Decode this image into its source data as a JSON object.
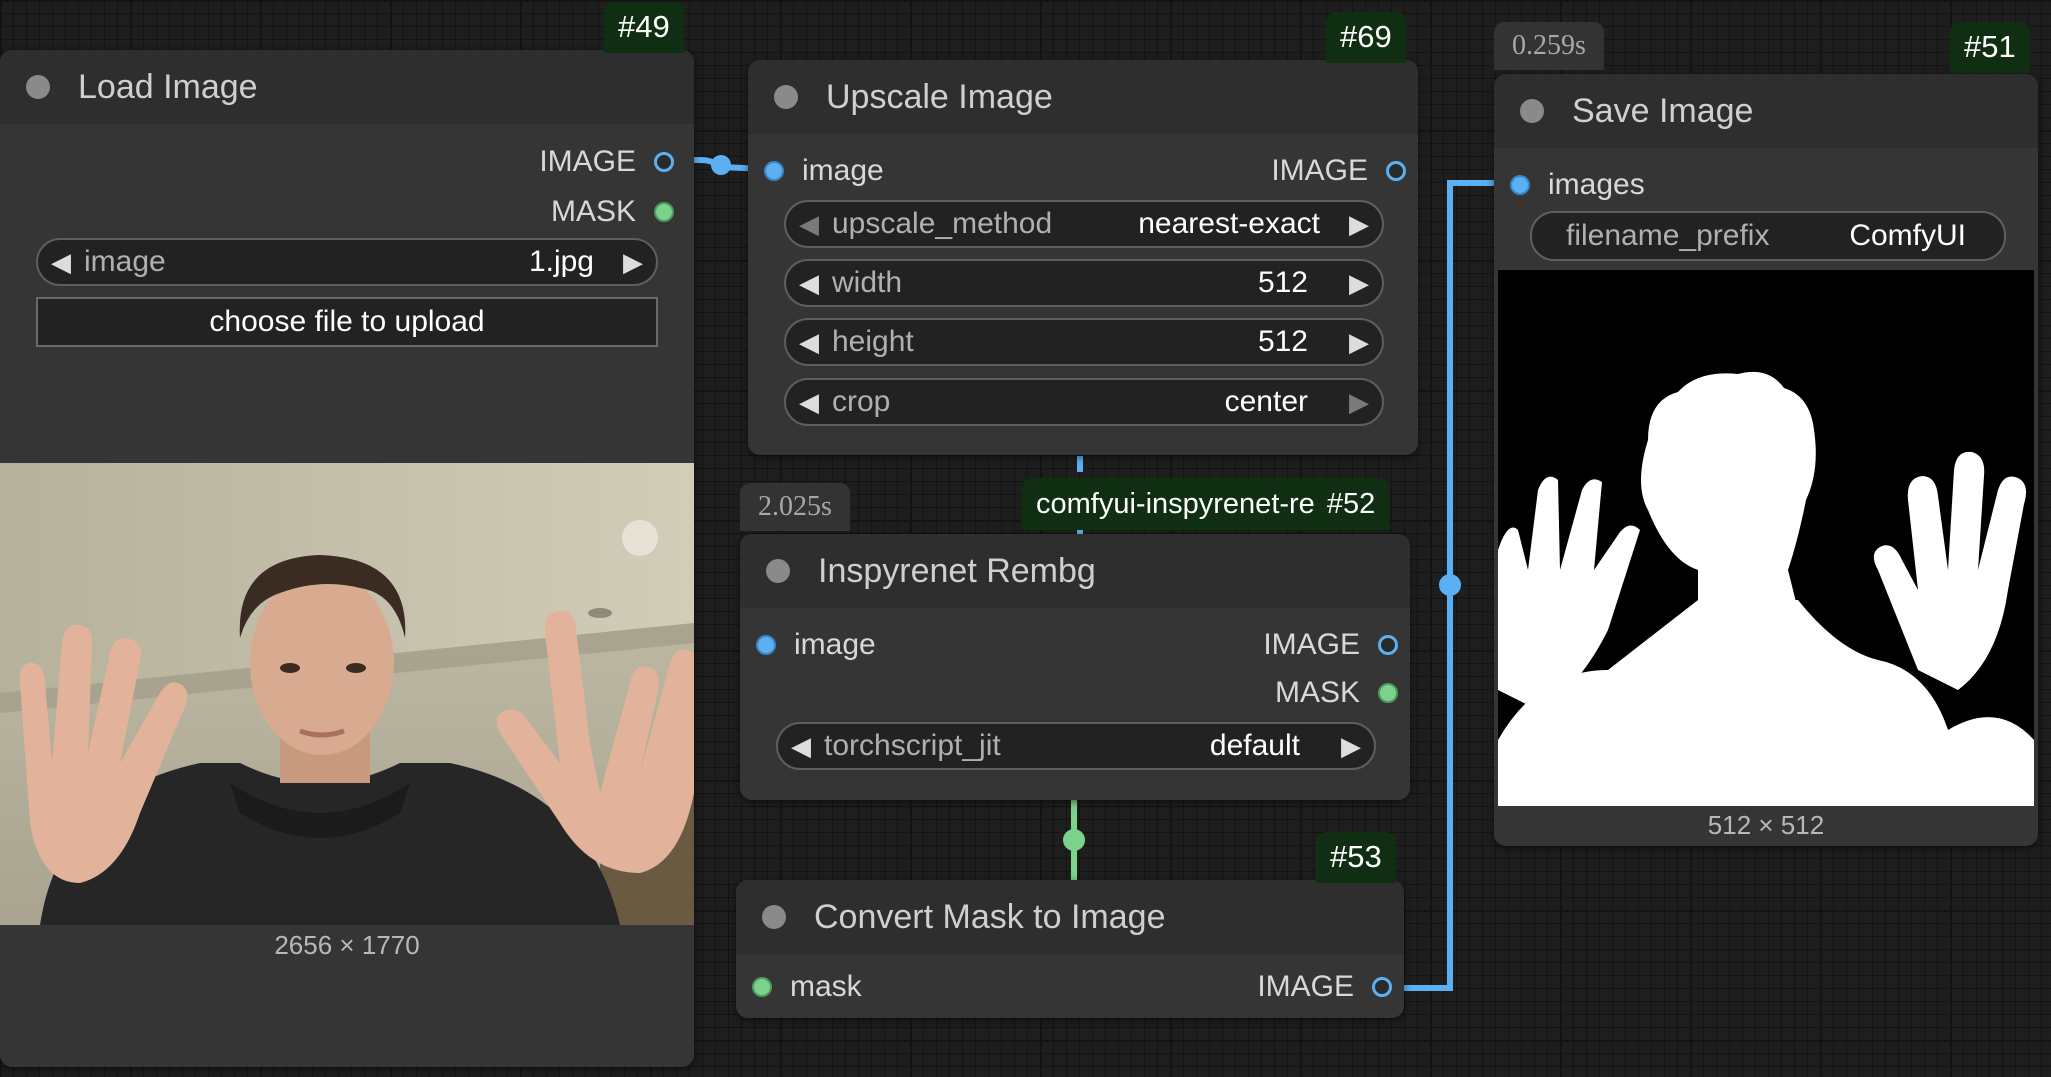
{
  "colors": {
    "canvas": "#1e1e1e",
    "node_body": "#353535",
    "node_title": "#2e2e2e",
    "badge_bg": "#0f2e12",
    "image_link": "#5ab0f2",
    "mask_link": "#7bd28a"
  },
  "load_image": {
    "badge": "#49",
    "title": "Load Image",
    "outputs": {
      "image": "IMAGE",
      "mask": "MASK"
    },
    "image_widget": {
      "label": "image",
      "value": "1.jpg"
    },
    "upload_button": "choose file to upload",
    "preview_size": "2656 × 1770"
  },
  "upscale_image": {
    "badge": "#69",
    "title": "Upscale Image",
    "input_label": "image",
    "output_label": "IMAGE",
    "widgets": [
      {
        "label": "upscale_method",
        "value": "nearest-exact"
      },
      {
        "label": "width",
        "value": "512"
      },
      {
        "label": "height",
        "value": "512"
      },
      {
        "label": "crop",
        "value": "center"
      }
    ]
  },
  "inspyrenet": {
    "timing": "2.025s",
    "badge_label": "comfyui-inspyrenet-re",
    "badge": "#52",
    "title": "Inspyrenet Rembg",
    "input_label": "image",
    "outputs": {
      "image": "IMAGE",
      "mask": "MASK"
    },
    "widget": {
      "label": "torchscript_jit",
      "value": "default"
    }
  },
  "convert_mask": {
    "badge": "#53",
    "title": "Convert Mask to Image",
    "input_label": "mask",
    "output_label": "IMAGE"
  },
  "save_image": {
    "timing": "0.259s",
    "badge": "#51",
    "title": "Save Image",
    "input_label": "images",
    "widget": {
      "label": "filename_prefix",
      "value": "ComfyUI"
    },
    "preview_size": "512 × 512"
  },
  "icons": {
    "node_status": "circle-icon",
    "decrement": "left-arrow-icon",
    "increment": "right-arrow-icon"
  }
}
